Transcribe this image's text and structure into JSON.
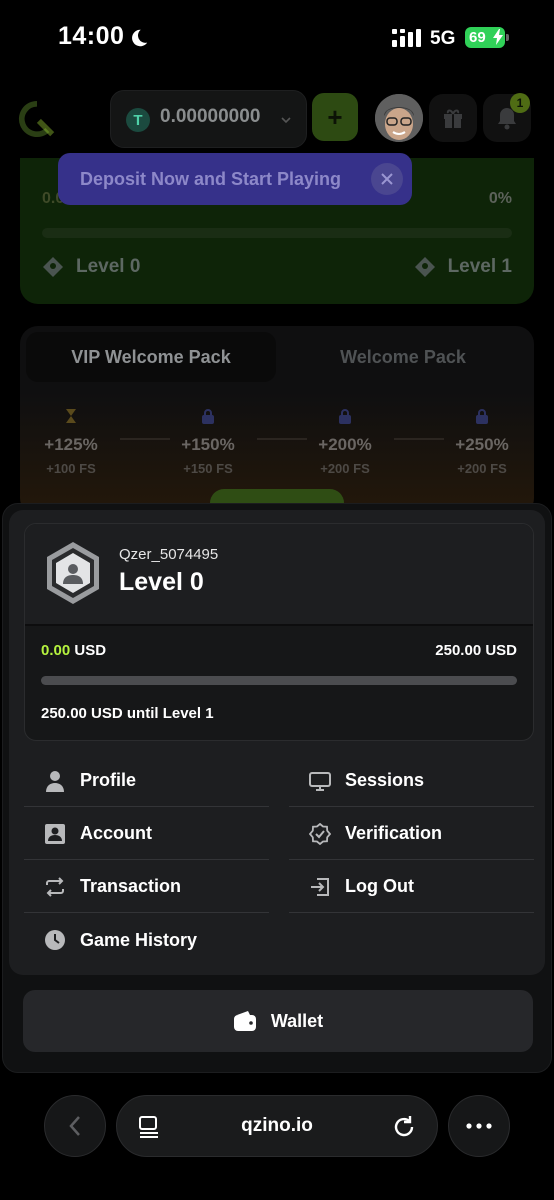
{
  "status_bar": {
    "time": "14:00",
    "network": "5G",
    "battery": "69"
  },
  "header": {
    "coin_symbol": "T",
    "balance": "0.00000000",
    "notification_count": "1"
  },
  "level_card": {
    "left_label": "0.00 / 5000",
    "percent": "0%",
    "from_level": "Level 0",
    "to_level": "Level 1"
  },
  "toast": {
    "text": "Deposit Now and Start Playing"
  },
  "welcome_pack": {
    "tabs": [
      "VIP Welcome Pack",
      "Welcome Pack"
    ],
    "tiers": [
      {
        "bonus": "+125%",
        "spins": "+100 FS"
      },
      {
        "bonus": "+150%",
        "spins": "+150 FS"
      },
      {
        "bonus": "+200%",
        "spins": "+200 FS"
      },
      {
        "bonus": "+250%",
        "spins": "+200 FS"
      }
    ]
  },
  "account_panel": {
    "username": "Qzer_5074495",
    "level": "Level 0",
    "current_amount": "0.00",
    "current_unit": " USD",
    "goal_amount": "250.00 USD",
    "progress_fraction": 0,
    "until_text": "250.00 USD until Level 1",
    "menu": {
      "profile": "Profile",
      "sessions": "Sessions",
      "account": "Account",
      "verification": "Verification",
      "transaction": "Transaction",
      "logout": "Log Out",
      "game_history": "Game History"
    },
    "wallet": "Wallet"
  },
  "browser": {
    "url": "qzino.io"
  },
  "colors": {
    "accent_green": "#b6f33f",
    "toast_purple": "#36318a",
    "panel_bg": "#1d1e20"
  }
}
